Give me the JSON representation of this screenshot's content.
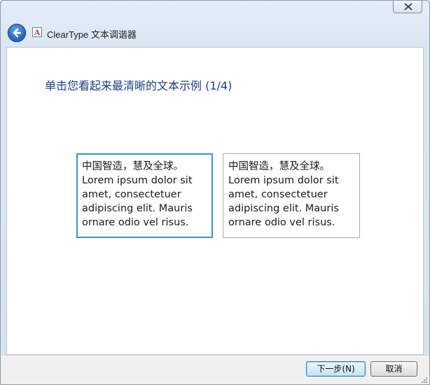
{
  "window": {
    "title": "ClearType 文本调谐器",
    "app_icon_glyph": "A",
    "close_icon": "close-icon",
    "back_icon": "back-arrow-icon"
  },
  "page": {
    "heading": "单击您看起来最清晰的文本示例 (1/4)"
  },
  "samples": [
    {
      "lines": [
        "中国智造，慧及全球。",
        "Lorem ipsum dolor sit",
        "amet, consectetuer",
        "adipiscing elit. Mauris",
        "ornare odio vel risus."
      ],
      "selected": true
    },
    {
      "lines": [
        "中国智造，慧及全球。",
        "Lorem ipsum dolor sit",
        "amet, consectetuer",
        "adipiscing elit. Mauris",
        "ornare odio vel risus."
      ],
      "selected": false
    }
  ],
  "footer": {
    "next_label": "下一步(N)",
    "cancel_label": "取消"
  },
  "colors": {
    "heading": "#1e3f86",
    "selected_border": "#3c8fd1",
    "window_frame": "#dbe7f3"
  }
}
